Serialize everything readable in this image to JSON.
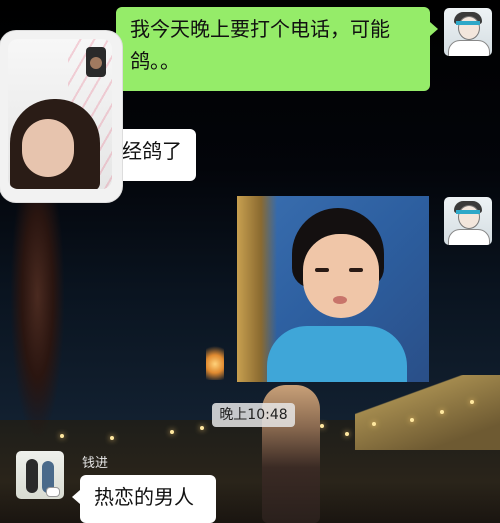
{
  "messages": {
    "outgoing_1": "我今天晚上要打个电话，可能鸽。。",
    "incoming_1_partial": "经鸽了",
    "timestamp": "晚上10:48",
    "sender_name": "钱进",
    "incoming_2": "热恋的男人"
  },
  "colors": {
    "outgoing_bubble": "#95ec69",
    "incoming_bubble": "#ffffff"
  },
  "icons": {
    "my_avatar": "avatar-anime-boy",
    "friend_avatar": "avatar-photo-two-people",
    "sticker": "sticker-girl-pout",
    "video_window": "floating-video-call"
  }
}
